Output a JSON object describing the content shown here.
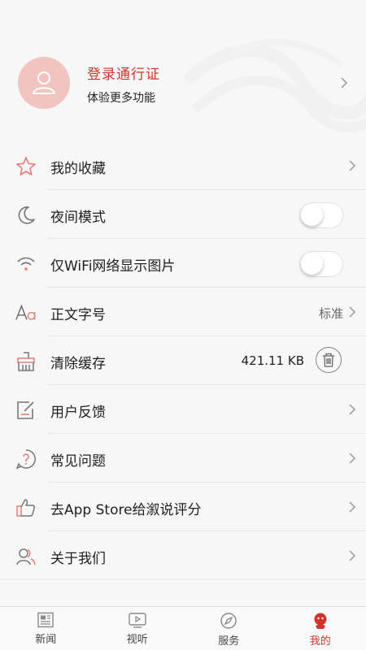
{
  "profile": {
    "title": "登录通行证",
    "subtitle": "体验更多功能"
  },
  "menu": {
    "favorites": {
      "label": "我的收藏",
      "icon": "star-icon"
    },
    "night_mode": {
      "label": "夜间模式",
      "icon": "moon-icon",
      "enabled": false
    },
    "wifi_images": {
      "label": "仅WiFi网络显示图片",
      "icon": "wifi-icon",
      "enabled": false
    },
    "font_size": {
      "label": "正文字号",
      "value": "标准",
      "icon": "font-size-icon"
    },
    "clear_cache": {
      "label": "清除缓存",
      "value": "421.11 KB",
      "icon": "broom-icon"
    },
    "feedback": {
      "label": "用户反馈",
      "icon": "edit-icon"
    },
    "faq": {
      "label": "常见问题",
      "icon": "question-icon"
    },
    "rate": {
      "label": "去App Store给溆说评分",
      "icon": "thumbs-up-icon"
    },
    "about": {
      "label": "关于我们",
      "icon": "users-icon"
    }
  },
  "tabbar": {
    "tabs": [
      {
        "label": "新闻",
        "icon": "news-icon",
        "active": false
      },
      {
        "label": "视听",
        "icon": "video-icon",
        "active": false
      },
      {
        "label": "服务",
        "icon": "compass-icon",
        "active": false
      },
      {
        "label": "我的",
        "icon": "mine-icon",
        "active": true
      }
    ]
  },
  "colors": {
    "accent": "#d0332d",
    "avatar_bg": "#f2c4c0",
    "background": "#f7f7f7"
  }
}
